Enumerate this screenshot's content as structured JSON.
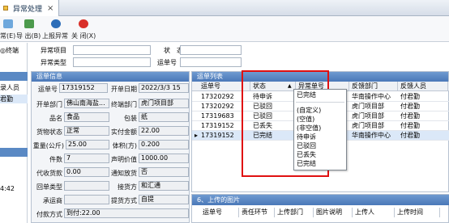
{
  "tab": {
    "label": "异常处理",
    "close": "×"
  },
  "toolbar": {
    "items": [
      {
        "label": "常(E)"
      },
      {
        "label": "导 出(B)"
      },
      {
        "label": "上报异常"
      },
      {
        "label": "关 闭(X)"
      }
    ]
  },
  "left_panel": {
    "radio_label": "◎终端",
    "column_header": "录人员",
    "selected_value": "君勤",
    "time": "4:42"
  },
  "filters": {
    "exception_item_label": "异常项目",
    "exception_type_label": "异常类型",
    "status_label": "状　态",
    "waybill_no_label": "运单号"
  },
  "waybill_info": {
    "header": "运单信息",
    "fields": {
      "waybill_no": {
        "label": "运单号",
        "value": "17319152"
      },
      "open_date": {
        "label": "开单日期",
        "value": "2022/3/3 15"
      },
      "open_dept": {
        "label": "开单部门",
        "value": "佛山南海盐..."
      },
      "final_dept": {
        "label": "终端部门",
        "value": "虎门项目部"
      },
      "product": {
        "label": "品名",
        "value": "食品"
      },
      "packaging": {
        "label": "包装",
        "value": "纸"
      },
      "cargo_status": {
        "label": "货物状态",
        "value": "正常"
      },
      "actual_amount": {
        "label": "实付金额",
        "value": "22.00"
      },
      "weight": {
        "label": "重量(公斤)",
        "value": "25.00"
      },
      "volume": {
        "label": "体积(方)",
        "value": "0.200"
      },
      "pieces": {
        "label": "件数",
        "value": "7"
      },
      "declared_value": {
        "label": "声明价值",
        "value": "1000.00"
      },
      "cod": {
        "label": "代收货款",
        "value": "0.00"
      },
      "notify_release": {
        "label": "通知放货",
        "value": "否"
      },
      "return_type": {
        "label": "回单类型",
        "value": ""
      },
      "receiver": {
        "label": "接货方",
        "value": "和汇通"
      },
      "carrier": {
        "label": "承运商",
        "value": ""
      },
      "pickup_method": {
        "label": "提货方式",
        "value": "自提"
      },
      "payment_method": {
        "label": "付款方式",
        "value": "到付:22.00"
      }
    }
  },
  "waybill_list": {
    "header": "运单列表",
    "columns": [
      "运单号",
      "状态",
      "异常单号",
      "反馈部门",
      "反馈人员"
    ],
    "rows": [
      {
        "waybill": "17320292",
        "status": "待申诉",
        "dept": "华南操作中心",
        "person": "付君勤",
        "selected": false
      },
      {
        "waybill": "17320292",
        "status": "已驳回",
        "dept": "虎门项目部",
        "person": "付君勤",
        "selected": false
      },
      {
        "waybill": "17319683",
        "status": "已驳回",
        "dept": "虎门项目部",
        "person": "付君勤",
        "selected": false
      },
      {
        "waybill": "17319152",
        "status": "已丢失",
        "dept": "虎门项目部",
        "person": "付君勤",
        "selected": false
      },
      {
        "waybill": "17319152",
        "status": "已完结",
        "dept": "华南操作中心",
        "person": "付君勤",
        "selected": true
      }
    ]
  },
  "status_filter_dropdown": {
    "items": [
      "已完结",
      "(自定义)",
      "(空值)",
      "(非空值)",
      "待申诉",
      "已驳回",
      "已丢失",
      "已完结"
    ]
  },
  "image_panel": {
    "header": "6、上传的图片",
    "columns": [
      "运单号",
      "责任环节",
      "上传部门",
      "图片说明",
      "上传人",
      "上传时间"
    ]
  },
  "colors": {
    "highlight_border": "#e01010",
    "panel_header": "#4a78b8",
    "selected_row": "#dbe8f8"
  }
}
